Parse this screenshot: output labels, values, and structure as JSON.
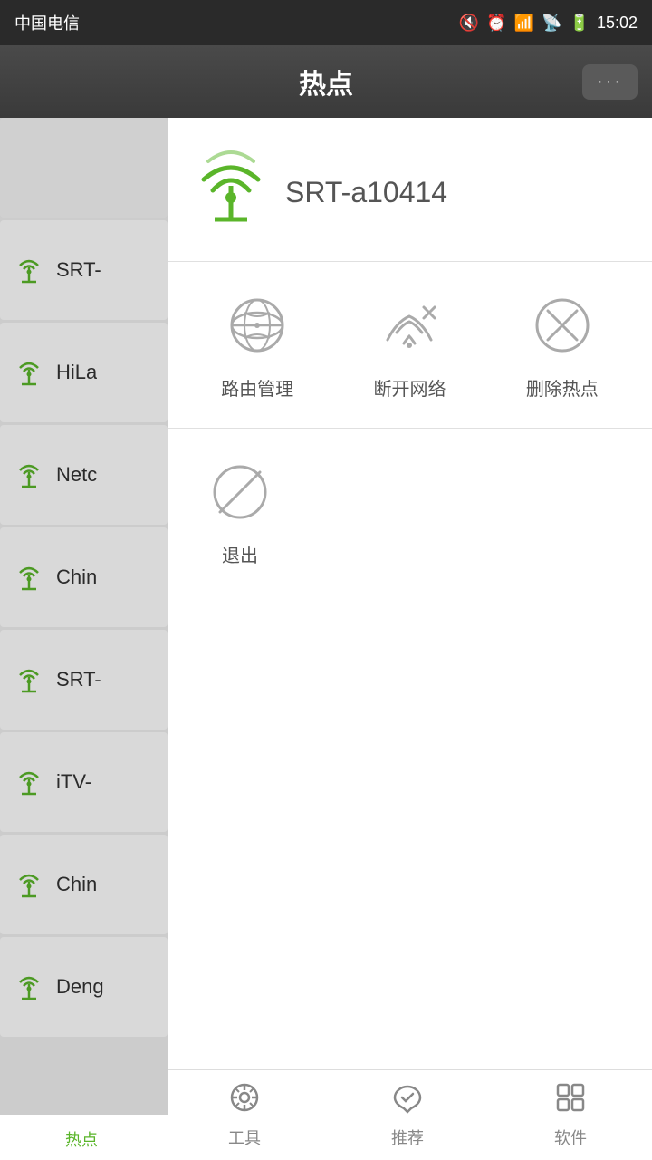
{
  "status_bar": {
    "carrier": "中国电信",
    "time": "15:02"
  },
  "title_bar": {
    "title": "热点",
    "more_btn_label": "···"
  },
  "popup": {
    "network_name": "SRT-a10414",
    "actions": [
      {
        "id": "router-manage",
        "label": "路由管理"
      },
      {
        "id": "disconnect",
        "label": "断开网络"
      },
      {
        "id": "delete-hotspot",
        "label": "删除热点"
      }
    ],
    "exit_label": "退出"
  },
  "wifi_list": {
    "items": [
      {
        "id": "item-1",
        "name": "SRT-"
      },
      {
        "id": "item-2",
        "name": "HiLa"
      },
      {
        "id": "item-3",
        "name": "Netc"
      },
      {
        "id": "item-4",
        "name": "Chin"
      },
      {
        "id": "item-5",
        "name": "SRT-"
      },
      {
        "id": "item-6",
        "name": "iTV-"
      },
      {
        "id": "item-7",
        "name": "Chin"
      },
      {
        "id": "item-8",
        "name": "Deng"
      }
    ]
  },
  "bottom_nav": {
    "items": [
      {
        "id": "hotspot",
        "label": "热点",
        "active": true
      },
      {
        "id": "tools",
        "label": "工具",
        "active": false
      },
      {
        "id": "recommend",
        "label": "推荐",
        "active": false
      },
      {
        "id": "software",
        "label": "软件",
        "active": false
      }
    ]
  }
}
